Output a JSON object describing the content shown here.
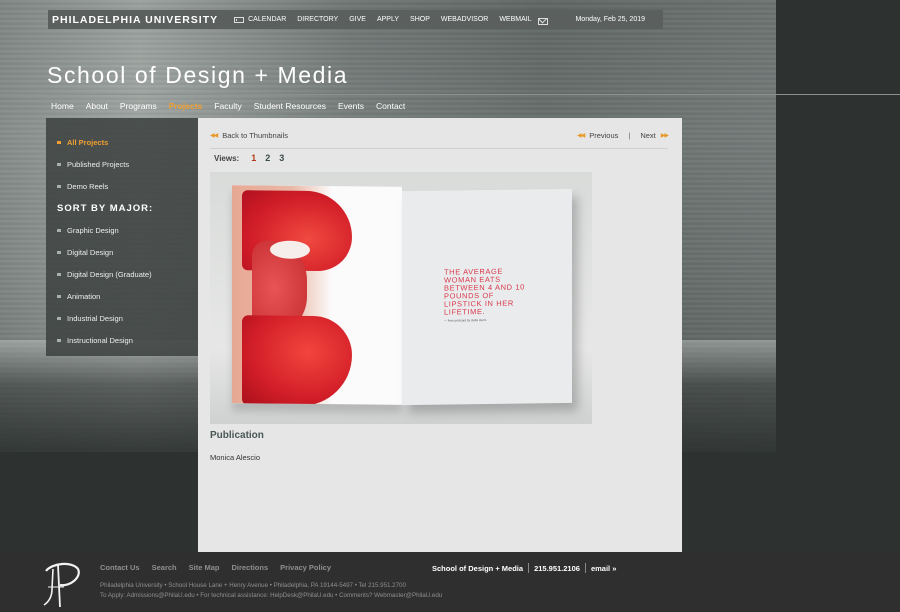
{
  "topbar": {
    "brand": "PHILADELPHIA UNIVERSITY",
    "links": [
      {
        "label": "CALENDAR",
        "icon": "calendar-icon"
      },
      {
        "label": "DIRECTORY"
      },
      {
        "label": "GIVE"
      },
      {
        "label": "APPLY"
      },
      {
        "label": "SHOP"
      },
      {
        "label": "WEBADVISOR"
      },
      {
        "label": "WEBMAIL",
        "icon": "mail-icon"
      }
    ],
    "date": "Monday, Feb 25, 2019"
  },
  "header": {
    "title": "School of Design + Media"
  },
  "nav": {
    "items": [
      {
        "label": "Home"
      },
      {
        "label": "About"
      },
      {
        "label": "Programs"
      },
      {
        "label": "Projects",
        "active": true
      },
      {
        "label": "Faculty"
      },
      {
        "label": "Student Resources"
      },
      {
        "label": "Events"
      },
      {
        "label": "Contact"
      }
    ]
  },
  "sidebar": {
    "items": [
      {
        "label": "All Projects",
        "active": true
      },
      {
        "label": "Published Projects"
      },
      {
        "label": "Demo Reels"
      }
    ],
    "sort_heading": "SORT BY MAJOR:",
    "majors": [
      {
        "label": "Graphic Design"
      },
      {
        "label": "Digital Design"
      },
      {
        "label": "Digital Design (Graduate)"
      },
      {
        "label": "Animation"
      },
      {
        "label": "Industrial Design"
      },
      {
        "label": "Instructional Design"
      }
    ]
  },
  "content": {
    "back_label": "Back to Thumbnails",
    "previous_label": "Previous",
    "separator": "|",
    "next_label": "Next",
    "views_label": "Views:",
    "views": [
      "1",
      "2",
      "3"
    ],
    "current_view": "1",
    "image": {
      "quote": "THE AVERAGE WOMAN EATS BETWEEN 4 AND 10 POUNDS OF LIPSTICK IN HER LIFETIME.",
      "credit": "— from postcard by stella starrs"
    },
    "project_title": "Publication",
    "project_author": "Monica Alescio"
  },
  "footer": {
    "links": [
      {
        "label": "Contact Us"
      },
      {
        "label": "Search"
      },
      {
        "label": "Site Map"
      },
      {
        "label": "Directions"
      },
      {
        "label": "Privacy Policy"
      }
    ],
    "address_line1": "Philadelphia University • School House Lane + Henry Avenue • Philadelphia, PA 19144-5497 • Tel 215.951.2700",
    "address_line2": "To Apply: Admissions@PhilaU.edu • For technical assistance: HelpDesk@PhilaU.edu • Comments? Webmaster@PhilaU.edu",
    "school": "School of Design + Media",
    "phone": "215.951.2106",
    "email_label": "email »"
  },
  "colors": {
    "accent": "#f0a030",
    "current_view": "#b23a1a",
    "panel_bg": "#e5e6e5",
    "footer_bg": "#2f2f2f",
    "topbar_bg": "#5b5f5e"
  }
}
